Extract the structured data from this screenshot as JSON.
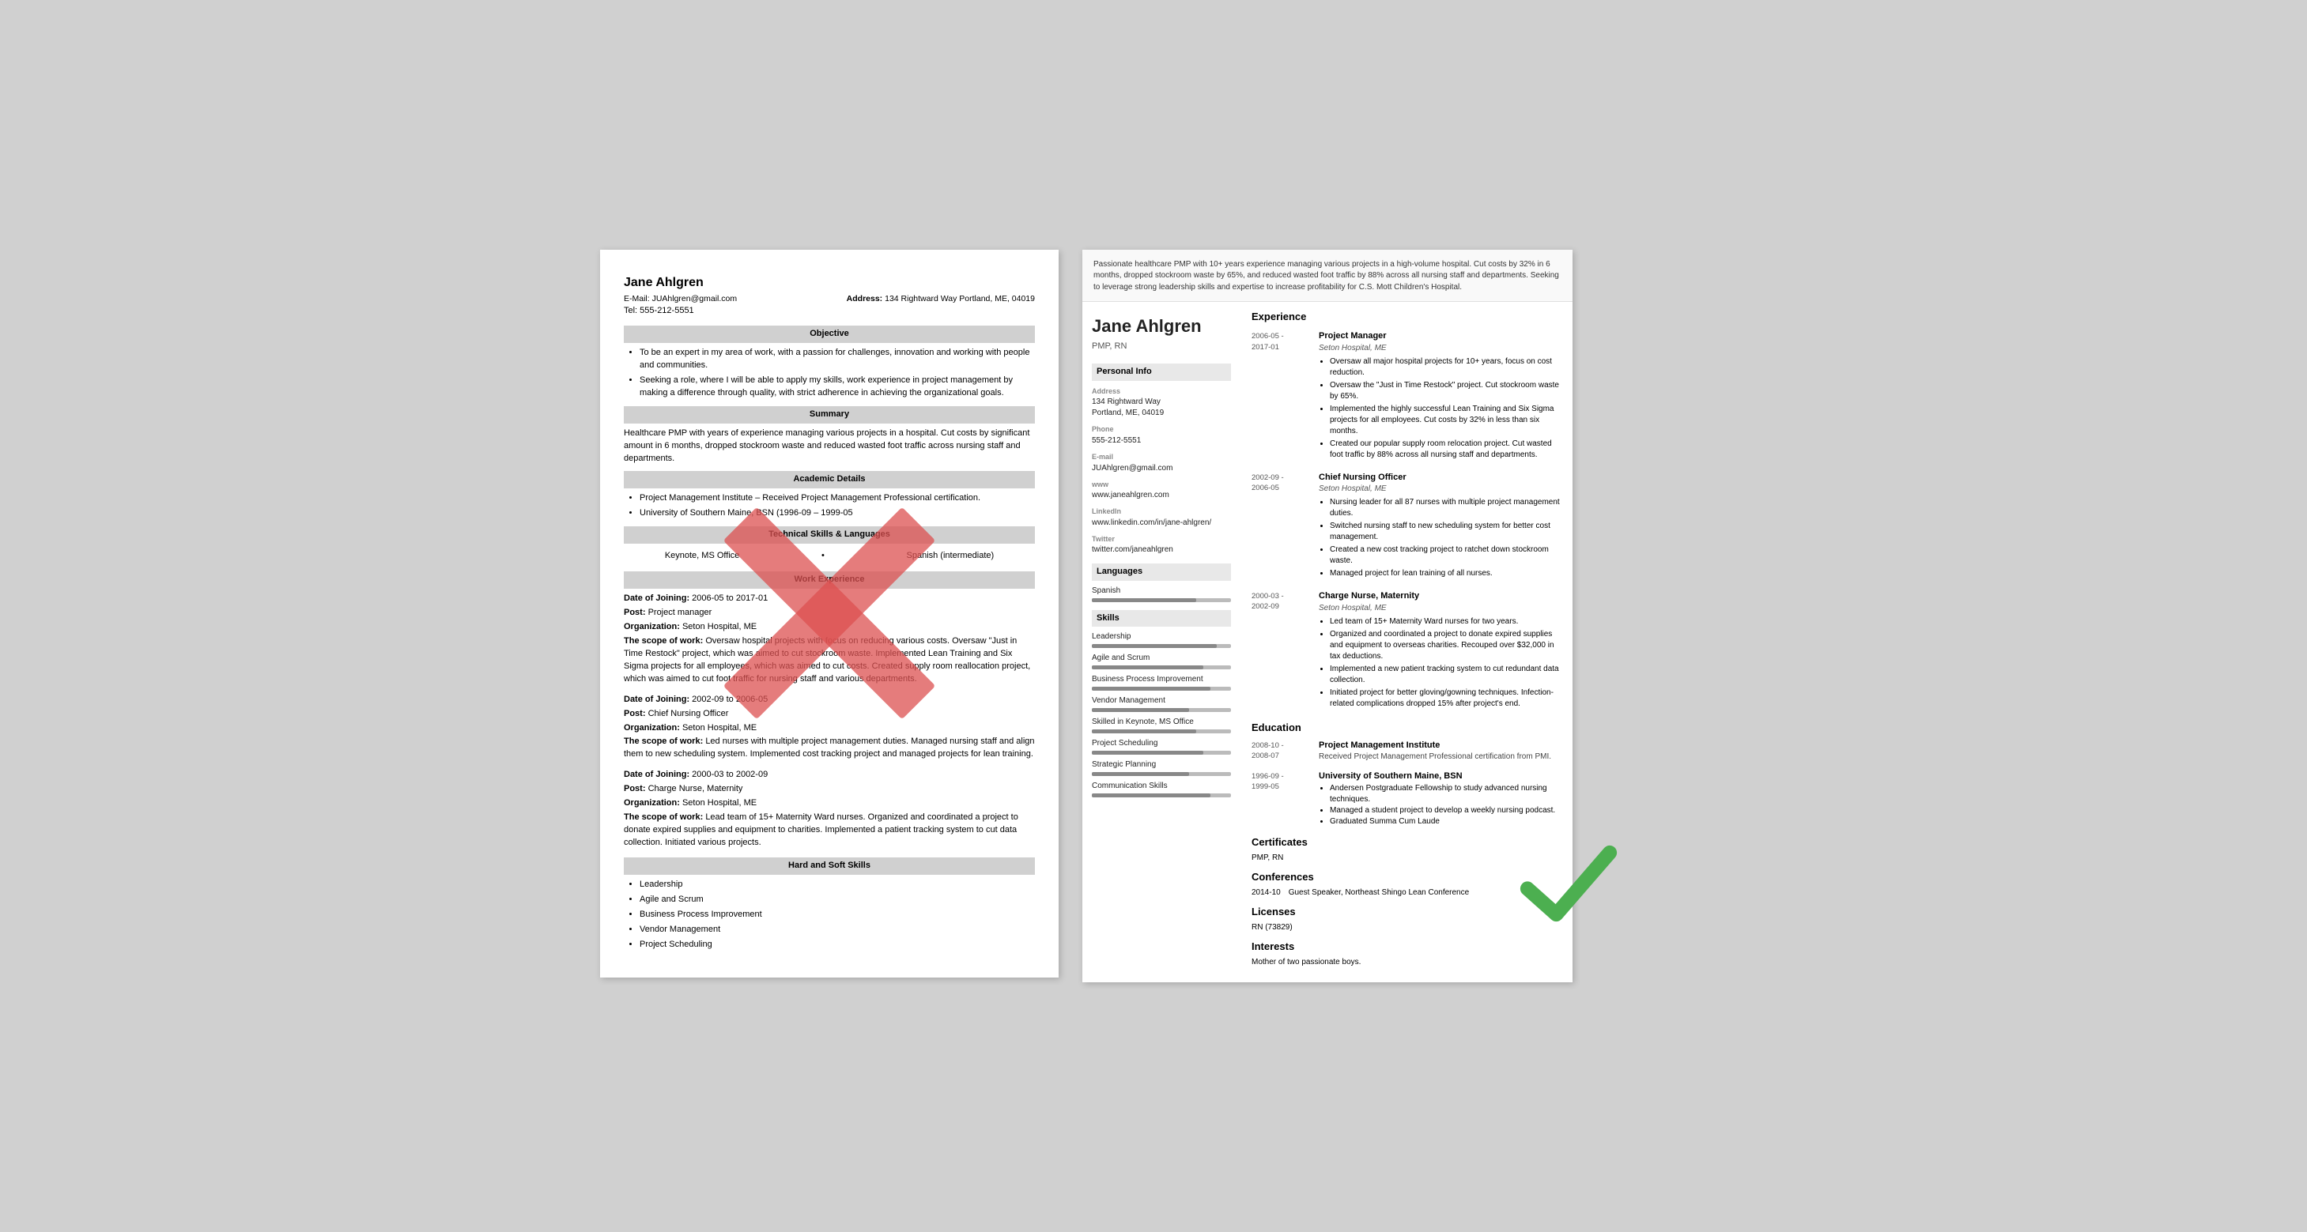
{
  "left_resume": {
    "name": "Jane Ahlgren",
    "email_label": "E-Mail: JUAhlgren@gmail.com",
    "address_label": "Address:",
    "address_value": "134 Rightward Way Portland, ME, 04019",
    "tel_label": "Tel: 555-212-5551",
    "sections": {
      "objective": {
        "title": "Objective",
        "bullets": [
          "To be an expert in my area of work, with a passion for challenges, innovation and working with people and communities.",
          "Seeking a role, where I will be able to apply my skills, work experience in project management by making a difference through quality, with strict adherence in achieving the organizational goals."
        ]
      },
      "summary": {
        "title": "Summary",
        "text": "Healthcare PMP with years of experience managing various projects in a hospital. Cut costs by significant amount in 6 months, dropped stockroom waste and reduced wasted foot traffic across nursing staff and departments."
      },
      "academic": {
        "title": "Academic Details",
        "bullets": [
          "Project Management Institute – Received Project Management Professional certification.",
          "University of Southern Maine, BSN (1996-09 – 1999-05"
        ]
      },
      "technical": {
        "title": "Technical Skills & Languages",
        "col1": "Keynote, MS Office",
        "col2": "Spanish (intermediate)"
      },
      "work": {
        "title": "Work Experience",
        "entries": [
          {
            "date_label": "Date of Joining:",
            "date_value": "2006-05 to 2017-01",
            "post_label": "Post:",
            "post_value": "Project manager",
            "org_label": "Organization:",
            "org_value": "Seton Hospital, ME",
            "scope_label": "The scope of work:",
            "scope_text": "Oversaw hospital projects with focus on reducing various costs. Oversaw \"Just in Time Restock\" project, which was aimed to cut stockroom waste. Implemented Lean Training and Six Sigma projects for all employees, which was aimed to cut costs. Created supply room reallocation project, which was aimed to cut foot traffic for nursing staff and various departments."
          },
          {
            "date_label": "Date of Joining:",
            "date_value": "2002-09 to 2006-05",
            "post_label": "Post:",
            "post_value": "Chief Nursing Officer",
            "org_label": "Organization:",
            "org_value": "Seton Hospital, ME",
            "scope_label": "The scope of work:",
            "scope_text": "Led nurses with multiple project management duties. Managed nursing staff and align them to new scheduling system. Implemented cost tracking project and managed projects for lean training."
          },
          {
            "date_label": "Date of Joining:",
            "date_value": "2000-03 to 2002-09",
            "post_label": "Post:",
            "post_value": "Charge Nurse, Maternity",
            "org_label": "Organization:",
            "org_value": "Seton Hospital, ME",
            "scope_label": "The scope of work:",
            "scope_text": "Lead team of 15+ Maternity Ward nurses. Organized and coordinated a project to donate expired supplies and equipment to charities. Implemented a patient tracking system to cut data collection. Initiated various projects."
          }
        ]
      },
      "skills": {
        "title": "Hard and Soft Skills",
        "bullets": [
          "Leadership",
          "Agile and Scrum",
          "Business Process Improvement",
          "Vendor Management",
          "Project Scheduling"
        ]
      }
    }
  },
  "right_resume": {
    "name": "Jane Ahlgren",
    "title": "PMP, RN",
    "summary": "Passionate healthcare PMP with 10+ years experience managing various projects in a high-volume hospital. Cut costs by 32% in 6 months, dropped stockroom waste by 65%, and reduced wasted foot traffic by 88% across all nursing staff and departments. Seeking to leverage strong leadership skills and expertise to increase profitability for C.S. Mott Children's Hospital.",
    "personal_info": {
      "section_title": "Personal Info",
      "address_label": "Address",
      "address_value": "134 Rightward Way\nPortland, ME, 04019",
      "phone_label": "Phone",
      "phone_value": "555-212-5551",
      "email_label": "E-mail",
      "email_value": "JUAhlgren@gmail.com",
      "www_label": "www",
      "www_value": "www.janeahlgren.com",
      "linkedin_label": "LinkedIn",
      "linkedin_value": "www.linkedin.com/in/jane-ahlgren/",
      "twitter_label": "Twitter",
      "twitter_value": "twitter.com/janeahlgren"
    },
    "languages": {
      "section_title": "Languages",
      "items": [
        {
          "name": "Spanish",
          "level": 75
        }
      ]
    },
    "skills": {
      "section_title": "Skills",
      "items": [
        {
          "name": "Leadership",
          "level": 90
        },
        {
          "name": "Agile and Scrum",
          "level": 80
        },
        {
          "name": "Business Process Improvement",
          "level": 85
        },
        {
          "name": "Vendor Management",
          "level": 70
        },
        {
          "name": "Skilled in Keynote, MS Office",
          "level": 75
        },
        {
          "name": "Project Scheduling",
          "level": 80
        },
        {
          "name": "Strategic Planning",
          "level": 70
        },
        {
          "name": "Communication Skills",
          "level": 85
        }
      ]
    },
    "experience": {
      "section_title": "Experience",
      "entries": [
        {
          "dates": "2006-05 -\n2017-01",
          "title": "Project Manager",
          "org": "Seton Hospital, ME",
          "bullets": [
            "Oversaw all major hospital projects for 10+ years, focus on cost reduction.",
            "Oversaw the \"Just in Time Restock\" project. Cut stockroom waste by 65%.",
            "Implemented the highly successful Lean Training and Six Sigma projects for all employees. Cut costs by 32% in less than six months.",
            "Created our popular supply room relocation project. Cut wasted foot traffic by 88% across all nursing staff and departments."
          ]
        },
        {
          "dates": "2002-09 -\n2006-05",
          "title": "Chief Nursing Officer",
          "org": "Seton Hospital, ME",
          "bullets": [
            "Nursing leader for all 87 nurses with multiple project management duties.",
            "Switched nursing staff to new scheduling system for better cost management.",
            "Created a new cost tracking project to ratchet down stockroom waste.",
            "Managed project for lean training of all nurses."
          ]
        },
        {
          "dates": "2000-03 -\n2002-09",
          "title": "Charge Nurse, Maternity",
          "org": "Seton Hospital, ME",
          "bullets": [
            "Led team of 15+ Maternity Ward nurses for two years.",
            "Organized and coordinated a project to donate expired supplies and equipment to overseas charities. Recouped over $32,000 in tax deductions.",
            "Implemented a new patient tracking system to cut redundant data collection.",
            "Initiated project for better gloving/gowning techniques. Infection-related complications dropped 15% after project's end."
          ]
        }
      ]
    },
    "education": {
      "section_title": "Education",
      "entries": [
        {
          "dates": "2008-10 -\n2008-07",
          "title": "Project Management Institute",
          "sub": "Received Project Management Professional certification from PMI."
        },
        {
          "dates": "1996-09 -\n1999-05",
          "title": "University of Southern Maine, BSN",
          "bullets": [
            "Andersen Postgraduate Fellowship to study advanced nursing techniques.",
            "Managed a student project to develop a weekly nursing podcast.",
            "Graduated Summa Cum Laude"
          ]
        }
      ]
    },
    "certificates": {
      "section_title": "Certificates",
      "value": "PMP, RN"
    },
    "conferences": {
      "section_title": "Conferences",
      "date": "2014-10",
      "value": "Guest Speaker, Northeast Shingo Lean Conference"
    },
    "licenses": {
      "section_title": "Licenses",
      "value": "RN (73829)"
    },
    "interests": {
      "section_title": "Interests",
      "value": "Mother of two passionate boys."
    }
  }
}
